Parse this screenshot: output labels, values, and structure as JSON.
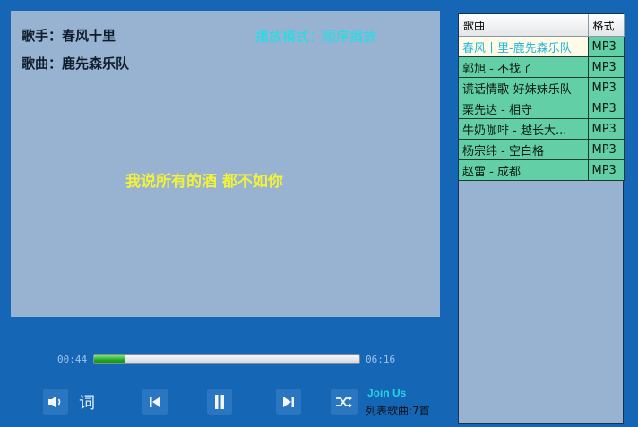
{
  "display": {
    "singer_label": "歌手：",
    "singer": "春风十里",
    "song_label": "歌曲：",
    "song": "鹿先森乐队",
    "mode_label": "播放模式：",
    "mode": "顺序播放",
    "lyric": "我说所有的酒 都不如你"
  },
  "player": {
    "elapsed": "00:44",
    "total": "06:16",
    "progress": 0.115,
    "lyric_button": "词",
    "join_text": "Join Us",
    "count_text": "列表歌曲:7首"
  },
  "playlist": {
    "headers": {
      "title": "歌曲",
      "format": "格式"
    },
    "rows": [
      {
        "title": "春风十里-鹿先森乐队",
        "format": "MP3"
      },
      {
        "title": "郭旭 - 不找了",
        "format": "MP3"
      },
      {
        "title": "谎话情歌-好妹妹乐队",
        "format": "MP3"
      },
      {
        "title": "栗先达 - 相守",
        "format": "MP3"
      },
      {
        "title": "牛奶咖啡 - 越长大...",
        "format": "MP3"
      },
      {
        "title": "杨宗纬 - 空白格",
        "format": "MP3"
      },
      {
        "title": "赵雷 - 成都",
        "format": "MP3"
      }
    ]
  },
  "colors": {
    "background": "#1566b5",
    "display": "#98b3d2",
    "row": "#63cfa6",
    "lyric": "#f3f237",
    "mode": "#1be0e6"
  },
  "icons": [
    "volume-icon",
    "previous-icon",
    "pause-icon",
    "next-icon",
    "shuffle-icon"
  ]
}
